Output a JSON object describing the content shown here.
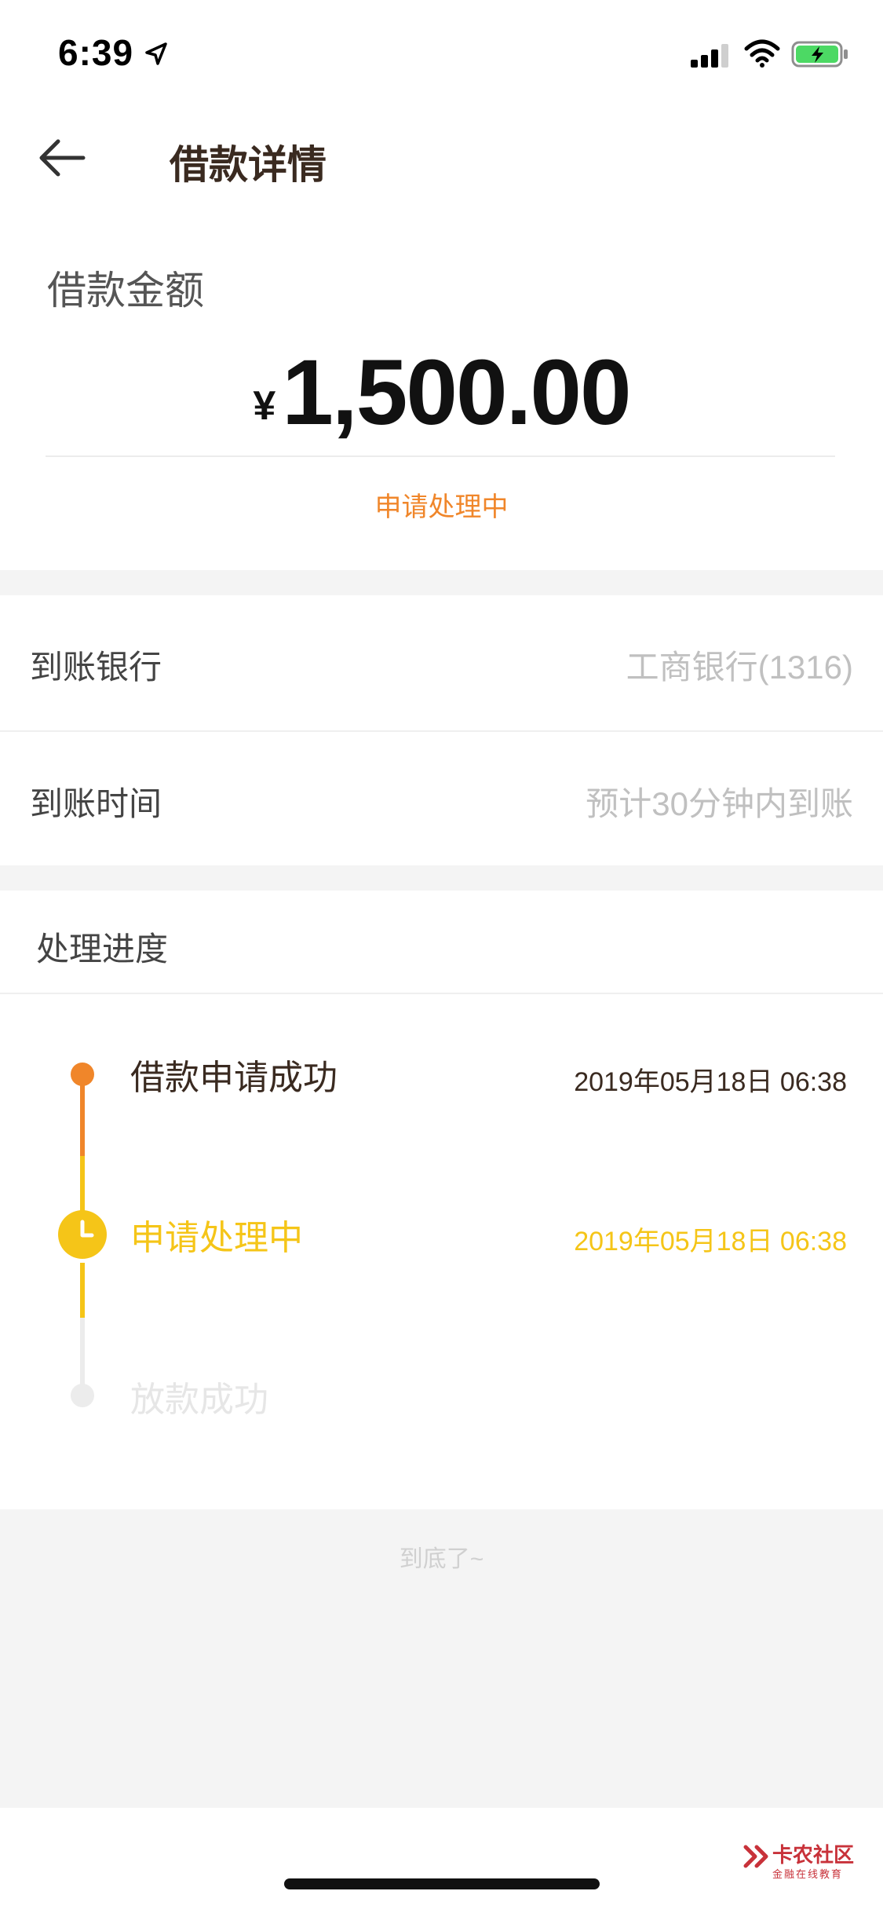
{
  "status_bar": {
    "time": "6:39",
    "icons": [
      "location-arrow-icon",
      "signal-icon",
      "wifi-icon",
      "battery-charging-icon"
    ]
  },
  "header": {
    "back_icon": "arrow-left-icon",
    "title": "借款详情"
  },
  "amount_section": {
    "label": "借款金额",
    "currency": "¥",
    "amount": "1,500.00",
    "status": "申请处理中"
  },
  "details": {
    "bank_label": "到账银行",
    "bank_value": "工商银行(1316)",
    "time_label": "到账时间",
    "time_value": "预计30分钟内到账"
  },
  "progress": {
    "title": "处理进度",
    "steps": [
      {
        "title": "借款申请成功",
        "time": "2019年05月18日 06:38",
        "state": "done"
      },
      {
        "title": "申请处理中",
        "time": "2019年05月18日 06:38",
        "state": "current"
      },
      {
        "title": "放款成功",
        "time": "",
        "state": "pending"
      }
    ]
  },
  "footer": {
    "end_text": "到底了~"
  },
  "watermark": {
    "title": "卡农社区",
    "subtitle": "金融在线教育"
  },
  "colors": {
    "accent_orange": "#f0862a",
    "current_yellow": "#f5c518",
    "pending_gray": "#e6e6e6",
    "title_brown": "#3a2a20"
  }
}
